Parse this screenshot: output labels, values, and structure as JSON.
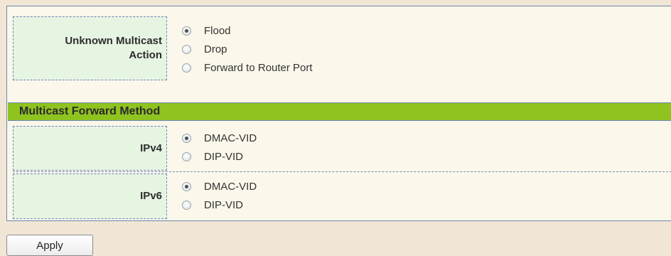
{
  "unknown_multicast": {
    "label_line1": "Unknown Multicast",
    "label_line2": "Action",
    "options": [
      {
        "label": "Flood",
        "selected": true
      },
      {
        "label": "Drop",
        "selected": false
      },
      {
        "label": "Forward to Router Port",
        "selected": false
      }
    ]
  },
  "forward_method": {
    "title": "Multicast Forward Method",
    "ipv4": {
      "label": "IPv4",
      "options": [
        {
          "label": "DMAC-VID",
          "selected": true
        },
        {
          "label": "DIP-VID",
          "selected": false
        }
      ]
    },
    "ipv6": {
      "label": "IPv6",
      "options": [
        {
          "label": "DMAC-VID",
          "selected": true
        },
        {
          "label": "DIP-VID",
          "selected": false
        }
      ]
    }
  },
  "actions": {
    "apply_label": "Apply"
  },
  "colors": {
    "section_header": "#8fc31f",
    "label_cell": "#e6f4e2",
    "panel": "#fbf7ea",
    "page": "#f1e6d6"
  }
}
